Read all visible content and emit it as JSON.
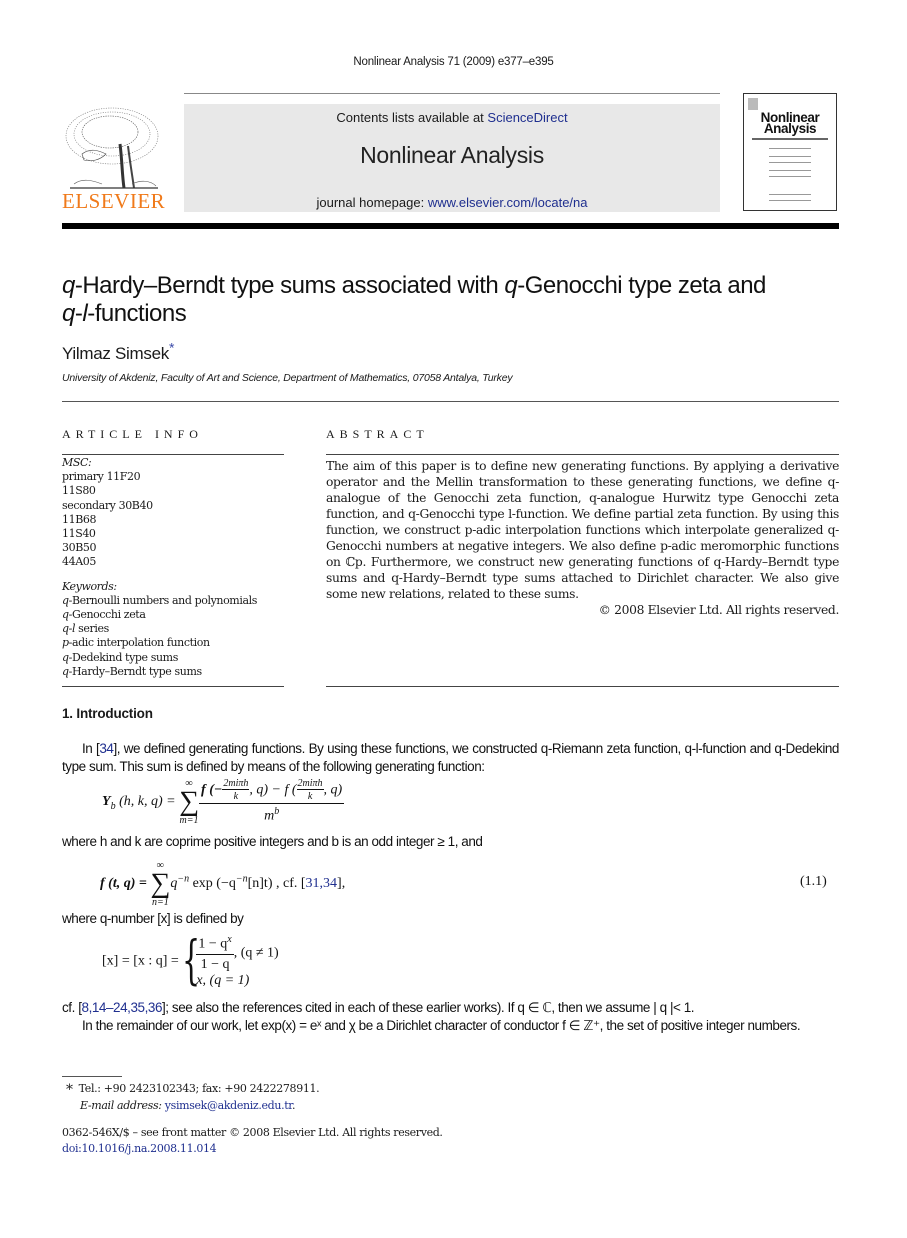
{
  "running_head": "Nonlinear Analysis 71 (2009) e377–e395",
  "masthead": {
    "publisher": "ELSEVIER",
    "contents_prefix": "Contents lists available at ",
    "contents_link": "ScienceDirect",
    "journal_name": "Nonlinear Analysis",
    "homepage_prefix": "journal homepage: ",
    "homepage_link": "www.elsevier.com/locate/na",
    "cover_title_line1": "Nonlinear",
    "cover_title_line2": "Analysis"
  },
  "article": {
    "title_q1": "q",
    "title_part1": "-Hardy–Berndt type sums associated with ",
    "title_q2": "q",
    "title_part2": "-Genocchi type zeta and",
    "title_q3": "q",
    "title_dash": "-",
    "title_l": "l",
    "title_part3": "-functions",
    "author": "Yilmaz Simsek",
    "author_mark": "*",
    "affiliation": "University of Akdeniz, Faculty of Art and Science, Department of Mathematics, 07058 Antalya, Turkey"
  },
  "article_info": {
    "heading": "ARTICLE INFO",
    "msc_label": "MSC:",
    "msc": [
      "primary 11F20",
      "11S80",
      "secondary 30B40",
      "11B68",
      "11S40",
      "30B50",
      "44A05"
    ],
    "keywords_label": "Keywords:",
    "keywords": [
      {
        "var": "q",
        "text": "-Bernoulli numbers and polynomials"
      },
      {
        "var": "q",
        "text": "-Genocchi zeta"
      },
      {
        "var": "q-l",
        "text": " series"
      },
      {
        "var": "p",
        "text": "-adic interpolation function"
      },
      {
        "var": "q",
        "text": "-Dedekind type sums"
      },
      {
        "var": "q",
        "text": "-Hardy–Berndt type sums"
      }
    ]
  },
  "abstract": {
    "heading": "ABSTRACT",
    "text": "The aim of this paper is to define new generating functions. By applying a derivative operator and the Mellin transformation to these generating functions, we define q-analogue of the Genocchi zeta function, q-analogue Hurwitz type Genocchi zeta function, and q-Genocchi type l-function. We define partial zeta function. By using this function, we construct p-adic interpolation functions which interpolate generalized q-Genocchi numbers at negative integers. We also define p-adic meromorphic functions on ℂp. Furthermore, we construct new generating functions of q-Hardy–Berndt type sums and q-Hardy–Berndt type sums attached to Dirichlet character. We also give some new relations, related to these sums.",
    "copyright": "© 2008 Elsevier Ltd. All rights reserved."
  },
  "introduction": {
    "heading": "1.  Introduction",
    "p1_a": "In [",
    "p1_ref": "34",
    "p1_b": "], we defined generating functions. By using these functions, we constructed q-Riemann zeta function, q-l-function and q-Dedekind type sum. This sum is defined by means of the following generating function:",
    "eq_yb": {
      "lhs": "Y",
      "lhs_sub": "b",
      "lhs_args": "(h, k, q) =",
      "sum_top": "∞",
      "sum_bottom": "m=1",
      "num_left": "f (−",
      "frac_num": "2miπh",
      "frac_den": "k",
      "num_mid": ", q) − f (",
      "num_right": ", q)",
      "den": "m",
      "den_sup": "b"
    },
    "where1": "where h and k are coprime positive integers and b is an odd integer ≥ 1, and",
    "eq_f": {
      "lhs": "f (t, q) =",
      "sum_top": "∞",
      "sum_bottom": "n=1",
      "body": "q",
      "body_sup": "−n",
      "exp": " exp (−q",
      "exp_sup": "−n",
      "exp_tail": "[n]t) , cf. [",
      "refs": "31,34",
      "tail": "],",
      "number": "(1.1)"
    },
    "where2": "where q-number [x] is defined by",
    "eq_x": {
      "lhs": "[x] = [x : q] =",
      "case1_num": "1 − q",
      "case1_num_sup": "x",
      "case1_den": "1 − q",
      "case1_cond": ",    (q ≠ 1)",
      "case2": "x,    (q = 1)"
    },
    "cf_a": "cf. [",
    "cf_refs": "8,14–24,35,36",
    "cf_b": "]; see also the references cited in each of these earlier works). If q ∈ ℂ, then we assume | q |< 1.",
    "p2": "In the remainder of our work, let exp(x) = eˣ and χ be a Dirichlet character of conductor f ∈ ℤ⁺, the set of positive integer numbers."
  },
  "footnote": {
    "mark": "*",
    "tel": "Tel.: +90 2423102343; fax: +90 2422278911.",
    "email_label": "E-mail address:",
    "email": "ysimsek@akdeniz.edu.tr",
    "email_tail": "."
  },
  "front_matter": {
    "issn": "0362-546X/$ – see front matter © 2008 Elsevier Ltd. All rights reserved.",
    "doi": "doi:10.1016/j.na.2008.11.014"
  },
  "colors": {
    "link": "#1f2f8f",
    "elsevier_orange": "#f07a1a",
    "masthead_bg": "#e8e8e8"
  }
}
